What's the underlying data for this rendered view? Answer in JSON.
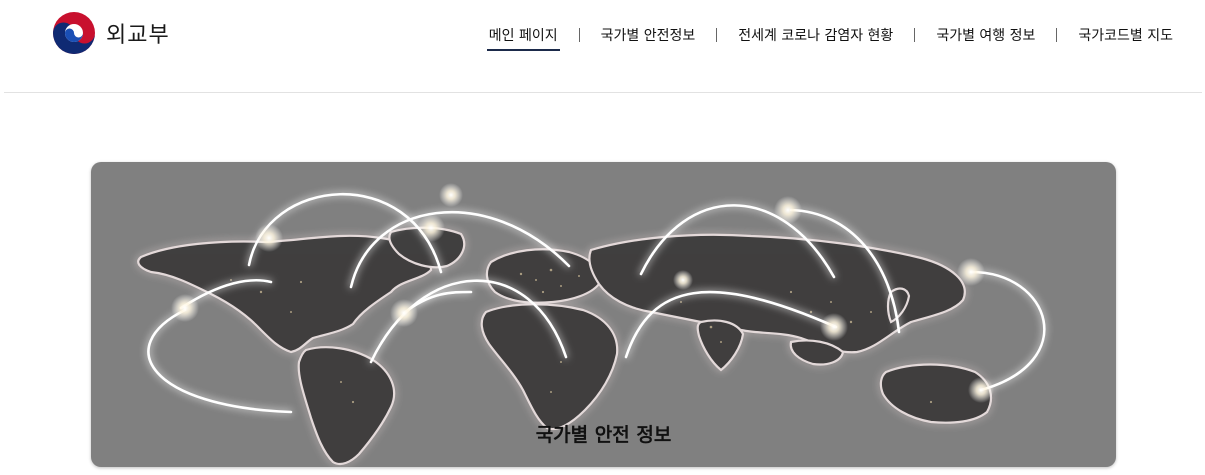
{
  "brand": {
    "name": "외교부",
    "logo_icon": "korea-taegeuk-icon"
  },
  "nav": {
    "items": [
      {
        "label": "메인 페이지",
        "active": true
      },
      {
        "label": "국가별 안전정보",
        "active": false
      },
      {
        "label": "전세계 코로나 감염자 현황",
        "active": false
      },
      {
        "label": "국가별 여행 정보",
        "active": false
      },
      {
        "label": "국가코드별 지도",
        "active": false
      }
    ]
  },
  "banner": {
    "title": "국가별 안전 정보",
    "image": "world-connections-map"
  },
  "colors": {
    "accent": "#1b2a4a",
    "banner_bg": "#808080"
  }
}
